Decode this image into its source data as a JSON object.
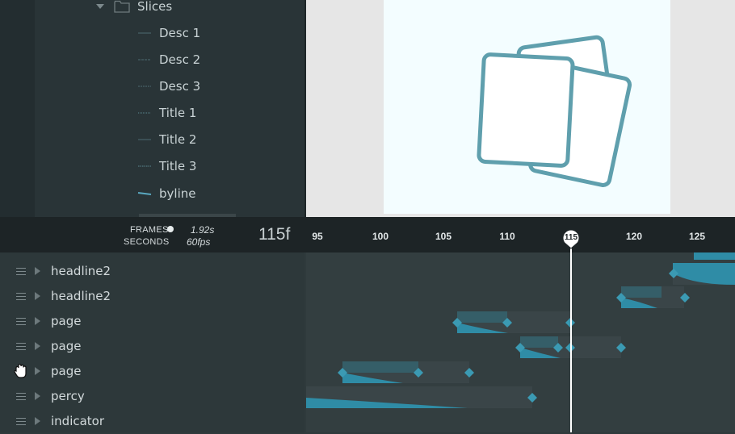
{
  "layers": {
    "folder": {
      "name": "Slices",
      "icon": "folder-icon",
      "expanded": true
    },
    "items": [
      {
        "name": "Desc 1"
      },
      {
        "name": "Desc 2"
      },
      {
        "name": "Desc 3"
      },
      {
        "name": "Title 1"
      },
      {
        "name": "Title 2"
      },
      {
        "name": "Title 3"
      },
      {
        "name": "byline"
      }
    ]
  },
  "timeline": {
    "frames_label": "FRAMES",
    "seconds_label": "SECONDS",
    "seconds_value": "1.92s",
    "fps_value": "60fps",
    "current_frame_display": "115f",
    "current_frame": 115,
    "ruler_ticks": [
      "95",
      "100",
      "105",
      "110",
      "115",
      "120",
      "125"
    ],
    "tracks": [
      {
        "name": "headline2"
      },
      {
        "name": "headline2"
      },
      {
        "name": "page"
      },
      {
        "name": "page"
      },
      {
        "name": "page",
        "cursor": "hand-grab-icon"
      },
      {
        "name": "percy"
      },
      {
        "name": "indicator"
      }
    ]
  },
  "colors": {
    "accent": "#3d96ad",
    "panel_dark": "#1d2426",
    "artboard_bg": "#f3fdff",
    "card_stroke": "#5f9fad"
  }
}
